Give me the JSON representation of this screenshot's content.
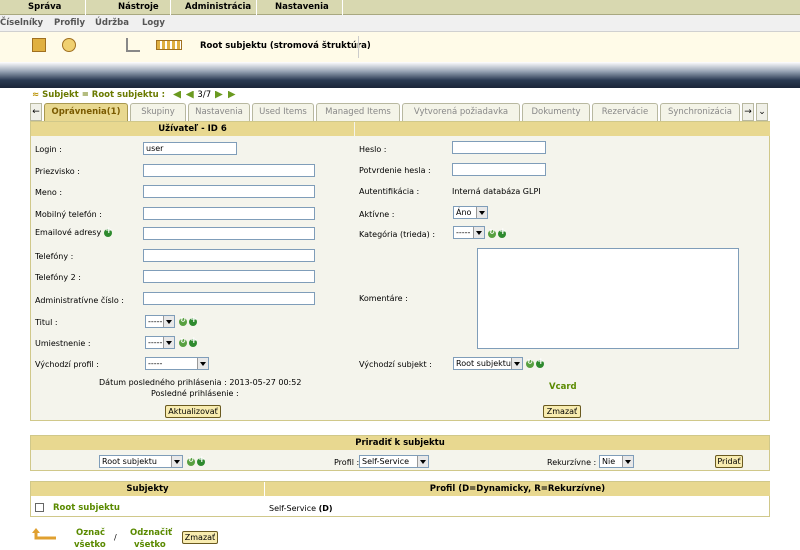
{
  "topmenu": {
    "items": [
      "Správa",
      "Nástroje",
      "Administrácia",
      "Nastavenia"
    ]
  },
  "submenu": {
    "items": [
      "Číselníky",
      "Profily",
      "Údržba",
      "Logy"
    ]
  },
  "toolbar": {
    "title": "Root subjektu (stromová štruktúra)"
  },
  "breadcrumb": {
    "text": "Subjekt = Root subjektu :",
    "position": "3/7"
  },
  "tabs": [
    "Oprávnenia(1)",
    "Skupiny",
    "Nastavenia",
    "Used Items",
    "Managed Items",
    "Vytvorená požiadavka",
    "Dokumenty",
    "Rezervácie",
    "Synchronizácia"
  ],
  "form": {
    "header": "Užívateľ - ID 6",
    "left": [
      {
        "label": "Login :",
        "value": "user"
      },
      {
        "label": "Priezvisko :",
        "value": ""
      },
      {
        "label": "Meno :",
        "value": ""
      },
      {
        "label": "Mobilný telefón :",
        "value": ""
      },
      {
        "label": "Emailové adresy :",
        "value": ""
      },
      {
        "label": "Telefóny :",
        "value": ""
      },
      {
        "label": "Telefóny 2 :",
        "value": ""
      },
      {
        "label": "Administratívne číslo :",
        "value": ""
      }
    ],
    "titul_label": "Titul :",
    "titul_value": "-----",
    "umiestnenie_label": "Umiestnenie :",
    "umiestnenie_value": "-----",
    "profil_label": "Východzí profil :",
    "profil_value": "-----",
    "last_login": "Dátum posledného prihlásenia : 2013-05-27 00:52",
    "last_login2": "Posledné prihlásenie :",
    "update_btn": "Aktualizovať",
    "right": {
      "heslo": "Heslo :",
      "potvrdenie": "Potvrdenie hesla :",
      "auth_label": "Autentifikácia :",
      "auth_value": "Interná databáza GLPI",
      "aktivne_label": "Aktívne :",
      "aktivne_value": "Áno",
      "kategoria_label": "Kategória (trieda) :",
      "kategoria_value": "-----",
      "komentare_label": "Komentáre :",
      "subjekt_label": "Východzí subjekt :",
      "subjekt_value": "Root subjektu",
      "vcard": "Vcard",
      "delete_btn": "Zmazať"
    }
  },
  "assign": {
    "header": "Priradiť k subjektu",
    "subjekt_value": "Root subjektu",
    "profil_label": "Profil :",
    "profil_value": "Self-Service",
    "rekurzivne_label": "Rekurzívne :",
    "rekurzivne_value": "Nie",
    "add_btn": "Pridať"
  },
  "list": {
    "col1": "Subjekty",
    "col2": "Profil (D=Dynamicky, R=Rekurzívne)",
    "row_subjekt": "Root subjektu",
    "row_profil": "Self-Service",
    "row_flag": "(D)"
  },
  "footer": {
    "check_all_1": "Označ",
    "check_all_2": "všetko",
    "slash": "/",
    "uncheck_all_1": "Odznačiť",
    "uncheck_all_2": "všetko",
    "delete_btn": "Zmazať"
  }
}
